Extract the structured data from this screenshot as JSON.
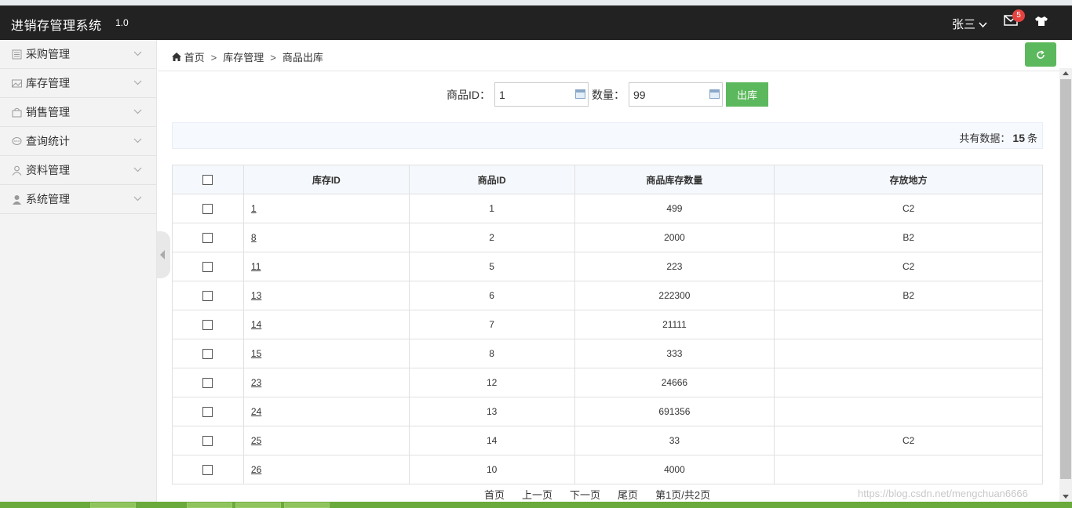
{
  "app": {
    "title": "进销存管理系统",
    "version": "1.0"
  },
  "header": {
    "user_name": "张三",
    "user_chevron": "⌵",
    "mail_icon": "mail-icon",
    "mail_badge": "5",
    "shirt_icon": "shirt-icon"
  },
  "sidebar": {
    "items": [
      {
        "label": "采购管理",
        "icon": "list-icon"
      },
      {
        "label": "库存管理",
        "icon": "picture-icon"
      },
      {
        "label": "销售管理",
        "icon": "bag-icon"
      },
      {
        "label": "查询统计",
        "icon": "comment-icon"
      },
      {
        "label": "资料管理",
        "icon": "user-outline-icon"
      },
      {
        "label": "系统管理",
        "icon": "user-solid-icon"
      }
    ]
  },
  "breadcrumb": {
    "home": "首页",
    "level1": "库存管理",
    "level2": "商品出库",
    "separator": ">"
  },
  "form": {
    "product_id_label": "商品ID：",
    "product_id_value": "1",
    "quantity_label": "数量：",
    "quantity_value": "99",
    "submit_label": "出库"
  },
  "summary": {
    "prefix": "共有数据：",
    "count": "15",
    "suffix": "条"
  },
  "table": {
    "headers": [
      "库存ID",
      "商品ID",
      "商品库存数量",
      "存放地方"
    ],
    "rows": [
      {
        "stock_id": "1",
        "product_id": "1",
        "quantity": "499",
        "location": "C2"
      },
      {
        "stock_id": "8",
        "product_id": "2",
        "quantity": "2000",
        "location": "B2"
      },
      {
        "stock_id": "11",
        "product_id": "5",
        "quantity": "223",
        "location": "C2"
      },
      {
        "stock_id": "13",
        "product_id": "6",
        "quantity": "222300",
        "location": "B2"
      },
      {
        "stock_id": "14",
        "product_id": "7",
        "quantity": "21111",
        "location": ""
      },
      {
        "stock_id": "15",
        "product_id": "8",
        "quantity": "333",
        "location": ""
      },
      {
        "stock_id": "23",
        "product_id": "12",
        "quantity": "24666",
        "location": ""
      },
      {
        "stock_id": "24",
        "product_id": "13",
        "quantity": "691356",
        "location": ""
      },
      {
        "stock_id": "25",
        "product_id": "14",
        "quantity": "33",
        "location": "C2"
      },
      {
        "stock_id": "26",
        "product_id": "10",
        "quantity": "4000",
        "location": ""
      }
    ]
  },
  "pager": {
    "first": "首页",
    "prev": "上一页",
    "next": "下一页",
    "last": "尾页",
    "info": "第1页/共2页"
  },
  "watermark": "https://blog.csdn.net/mengchuan6666",
  "colors": {
    "header_bg": "#222222",
    "accent_green": "#5cb85c",
    "badge_red": "#e64340"
  }
}
